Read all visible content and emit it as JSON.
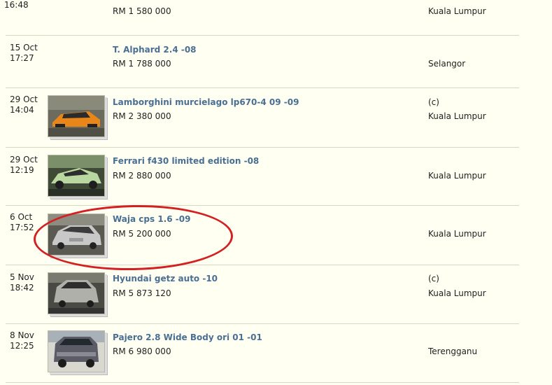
{
  "listings": [
    {
      "date": "",
      "time": "16:48",
      "title": "",
      "price": "RM 1 580 000",
      "company": "",
      "location": "Kuala Lumpur",
      "has_image": false
    },
    {
      "date": "15 Oct",
      "time": "17:27",
      "title": "T. Alphard 2.4 -08",
      "price": "RM 1 788 000",
      "company": "",
      "location": "Selangor",
      "has_image": false
    },
    {
      "date": "29 Oct",
      "time": "14:04",
      "title": "Lamborghini murcielago lp670-4 09 -09",
      "price": "RM 2 380 000",
      "company": "(c)",
      "location": "Kuala Lumpur",
      "has_image": true,
      "image": "orange-lamborghini-photo"
    },
    {
      "date": "29 Oct",
      "time": "12:19",
      "title": "Ferrari f430 limited edition -08",
      "price": "RM 2 880 000",
      "company": "",
      "location": "Kuala Lumpur",
      "has_image": true,
      "image": "green-ferrari-photo"
    },
    {
      "date": "6 Oct",
      "time": "17:52",
      "title": "Waja cps 1.6 -09",
      "price": "RM 5 200 000",
      "company": "",
      "location": "Kuala Lumpur",
      "has_image": true,
      "image": "silver-waja-photo"
    },
    {
      "date": "5 Nov",
      "time": "18:42",
      "title": "Hyundai getz auto -10",
      "price": "RM 5 873 120",
      "company": "(c)",
      "location": "Kuala Lumpur",
      "has_image": true,
      "image": "silver-getz-photo"
    },
    {
      "date": "8 Nov",
      "time": "12:25",
      "title": "Pajero 2.8 Wide Body ori 01 -01",
      "price": "RM 6 980 000",
      "company": "",
      "location": "Terengganu",
      "has_image": true,
      "image": "pajero-photo"
    }
  ],
  "colors": {
    "title": "#4a6f93",
    "background": "#fffff2",
    "highlight_circle": "#d42020"
  }
}
